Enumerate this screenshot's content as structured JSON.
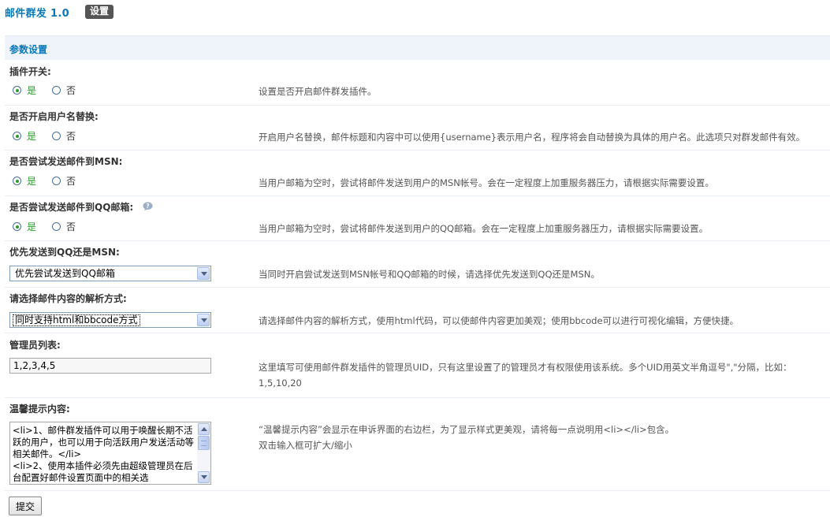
{
  "header": {
    "title": "邮件群发 1.0",
    "settings_label": "设置"
  },
  "section": {
    "title": "参数设置"
  },
  "settings": [
    {
      "label": "插件开关:",
      "type": "radio",
      "options": [
        "是",
        "否"
      ],
      "selected": "是",
      "description": "设置是否开启邮件群发插件。"
    },
    {
      "label": "是否开启用户名替换:",
      "type": "radio",
      "options": [
        "是",
        "否"
      ],
      "selected": "是",
      "description": "开启用户名替换，邮件标题和内容中可以使用{username}表示用户名，程序将会自动替换为具体的用户名。此选项只对群发邮件有效。"
    },
    {
      "label": "是否尝试发送邮件到MSN:",
      "type": "radio",
      "options": [
        "是",
        "否"
      ],
      "selected": "是",
      "description": "当用户邮箱为空时，尝试将邮件发送到用户的MSN帐号。会在一定程度上加重服务器压力，请根据实际需要设置。"
    },
    {
      "label": "是否尝试发送邮件到QQ邮箱:",
      "type": "radio",
      "options": [
        "是",
        "否"
      ],
      "selected": "是",
      "has_help_icon": true,
      "help_icon": "question-bubble-icon",
      "description": "当用户邮箱为空时，尝试将邮件发送到用户的QQ邮箱。会在一定程度上加重服务器压力，请根据实际需要设置。"
    },
    {
      "label": "优先发送到QQ还是MSN:",
      "type": "select",
      "value": "优先尝试发送到QQ邮箱",
      "description": "当同时开启尝试发送到MSN帐号和QQ邮箱的时候，请选择优先发送到QQ还是MSN。"
    },
    {
      "label": "请选择邮件内容的解析方式:",
      "type": "select",
      "value": "同时支持html和bbcode方式",
      "focused": true,
      "description": "请选择邮件内容的解析方式，使用html代码，可以使邮件内容更加美观；使用bbcode可以进行可视化编辑，方便快捷。"
    },
    {
      "label": "管理员列表:",
      "type": "text",
      "value": "1,2,3,4,5",
      "description": "这里填写可使用邮件群发插件的管理员UID，只有这里设置了的管理员才有权限使用该系统。多个UID用英文半角逗号\",\"分隔，比如：1,5,10,20"
    },
    {
      "label": "温馨提示内容:",
      "type": "textarea",
      "value": "<li>1、邮件群发插件可以用于唤醒长期不活跃的用户，也可以用于向活跃用户发送活动等相关邮件。</li>\n<li>2、使用本插件必须先由超级管理员在后台配置好邮件设置页面中的相关选",
      "description_lines": [
        "“温馨提示内容”会显示在申诉界面的右边栏，为了显示样式更美观，请将每一点说明用<li></li>包含。",
        "双击输入框可扩大/缩小"
      ]
    }
  ],
  "submit_label": "提交",
  "colors": {
    "accent": "#0a79b8",
    "section_bg": "#eef4fa",
    "radio_selected": "#2a9b2a",
    "badge_bg": "#555555"
  }
}
